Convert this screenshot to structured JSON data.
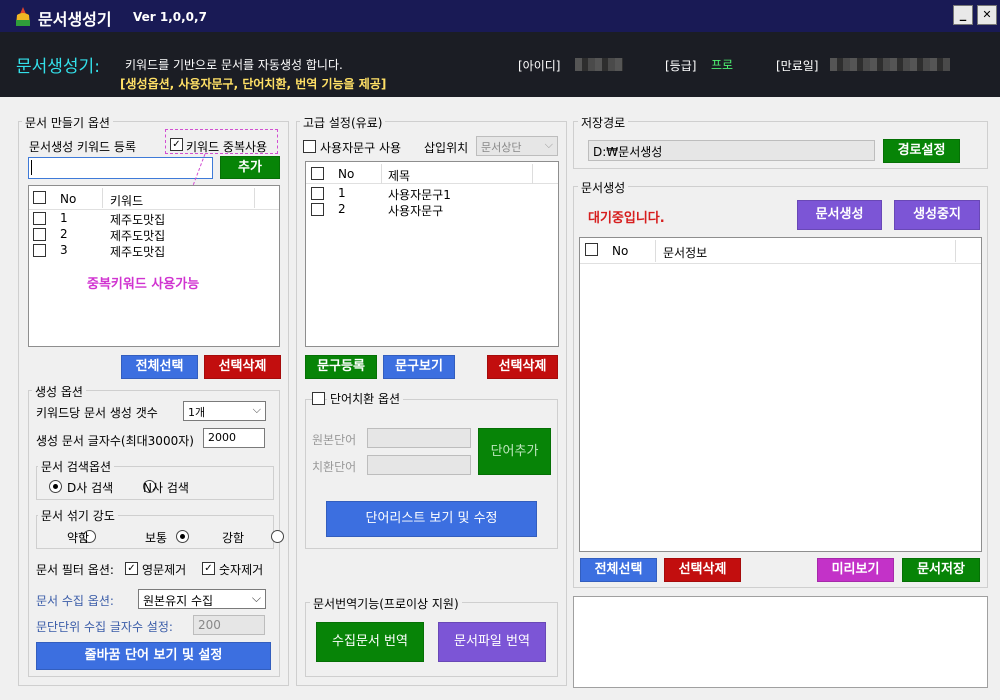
{
  "app": {
    "title": "문서생성기",
    "version": "Ver 1,0,0,7",
    "min": "_",
    "close": "✕"
  },
  "header": {
    "title": "문서생성기:",
    "desc": "키워드를 기반으로 문서를 자동생성 합니다.",
    "sub": "[생성옵션, 사용자문구, 단어치환, 번역 기능을 제공]",
    "id_label": "[아이디]",
    "grade_label": "[등급]",
    "grade_value": "프로",
    "expire_label": "[만료일]"
  },
  "doc_options": {
    "title": "문서 만들기 옵션",
    "kw_register": "문서생성 키워드 등록",
    "dup_label": "키워드 중복사용",
    "dup_checked": true,
    "add": "추가",
    "columns": [
      "No",
      "키워드"
    ],
    "rows": [
      {
        "no": "1",
        "kw": "제주도맛집"
      },
      {
        "no": "2",
        "kw": "제주도맛집"
      },
      {
        "no": "3",
        "kw": "제주도맛집"
      }
    ],
    "dup_note": "중복키워드 사용가능",
    "select_all": "전체선택",
    "delete_selected": "선택삭제"
  },
  "gen_options": {
    "title": "생성 옵션",
    "count_label": "키워드당 문서 생성 갯수",
    "count_value": "1개",
    "chars_label": "생성 문서 글자수(최대3000자)",
    "chars_value": "2000",
    "search_title": "문서 검색옵션",
    "search_d": "D사 검색",
    "search_n": "N사 검색",
    "mix_title": "문서 섞기 강도",
    "mix_weak": "약함",
    "mix_normal": "보통",
    "mix_strong": "강함",
    "filter_label": "문서 필터 옵션:",
    "filter_en": "영문제거",
    "filter_num": "숫자제거",
    "collect_label": "문서 수집 옵션:",
    "collect_value": "원본유지 수집",
    "para_label": "문단단위 수집 글자수 설정:",
    "para_value": "200",
    "linebreak_btn": "줄바꿈 단어 보기 및 설정"
  },
  "advanced": {
    "title": "고급 설정(유료)",
    "use_phrase": "사용자문구 사용",
    "insert_pos_label": "삽입위치",
    "insert_pos": "문서상단",
    "columns": [
      "No",
      "제목"
    ],
    "rows": [
      {
        "no": "1",
        "title": "사용자문구1"
      },
      {
        "no": "2",
        "title": "사용자문구"
      }
    ],
    "register": "문구등록",
    "view": "문구보기",
    "delete_selected": "선택삭제",
    "replace_title": "단어치환 옵션",
    "orig_label": "원본단어",
    "repl_label": "치환단어",
    "add_word": "단어추가",
    "word_list_btn": "단어리스트 보기 및 수정"
  },
  "translate": {
    "title": "문서번역기능(프로이상 지원)",
    "translate_collected": "수집문서 번역",
    "translate_file": "문서파일 번역"
  },
  "save_path": {
    "title": "저장경로",
    "value": "D:₩문서생성",
    "btn": "경로설정"
  },
  "doc_gen": {
    "title": "문서생성",
    "status": "대기중입니다.",
    "generate": "문서생성",
    "stop": "생성중지",
    "columns": [
      "No",
      "문서정보"
    ],
    "select_all": "전체선택",
    "delete_selected": "선택삭제",
    "preview": "미리보기",
    "save": "문서저장"
  }
}
